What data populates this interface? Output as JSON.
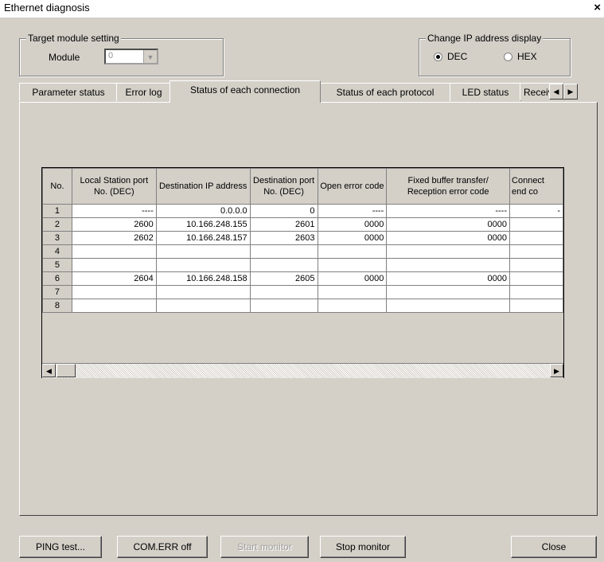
{
  "window": {
    "title": "Ethernet diagnosis",
    "close_glyph": "×"
  },
  "target_module": {
    "legend": "Target module setting",
    "module_label": "Module",
    "module_value": "0"
  },
  "ip_display": {
    "legend": "Change IP address display",
    "options": [
      "DEC",
      "HEX"
    ],
    "selected": "DEC"
  },
  "tabs": [
    "Parameter status",
    "Error log",
    "Status of each connection",
    "Status of each protocol",
    "LED status",
    "Receiv"
  ],
  "active_tab": "Status of each connection",
  "table": {
    "columns": [
      "No.",
      "Local Station port No. (DEC)",
      "Destination IP address",
      "Destination port No. (DEC)",
      "Open error code",
      "Fixed buffer transfer/ Reception error code",
      "Connect end co"
    ],
    "rows": [
      [
        "1",
        "----",
        "0.0.0.0",
        "0",
        "----",
        "----",
        "-"
      ],
      [
        "2",
        "2600",
        "10.166.248.155",
        "2601",
        "0000",
        "0000",
        ""
      ],
      [
        "3",
        "2602",
        "10.166.248.157",
        "2603",
        "0000",
        "0000",
        ""
      ],
      [
        "4",
        "",
        "",
        "",
        "",
        "",
        ""
      ],
      [
        "5",
        "",
        "",
        "",
        "",
        "",
        ""
      ],
      [
        "6",
        "2604",
        "10.166.248.158",
        "2605",
        "0000",
        "0000",
        ""
      ],
      [
        "7",
        "",
        "",
        "",
        "",
        "",
        ""
      ],
      [
        "8",
        "",
        "",
        "",
        "",
        "",
        ""
      ]
    ]
  },
  "buttons": {
    "ping": "PING test...",
    "com_err": "COM.ERR off",
    "start_monitor": "Start monitor",
    "stop_monitor": "Stop monitor",
    "close": "Close"
  },
  "icons": [
    "close-icon",
    "dropdown-arrow-icon",
    "tab-scroll-left-icon",
    "tab-scroll-right-icon",
    "scroll-left-icon",
    "scroll-right-icon"
  ]
}
